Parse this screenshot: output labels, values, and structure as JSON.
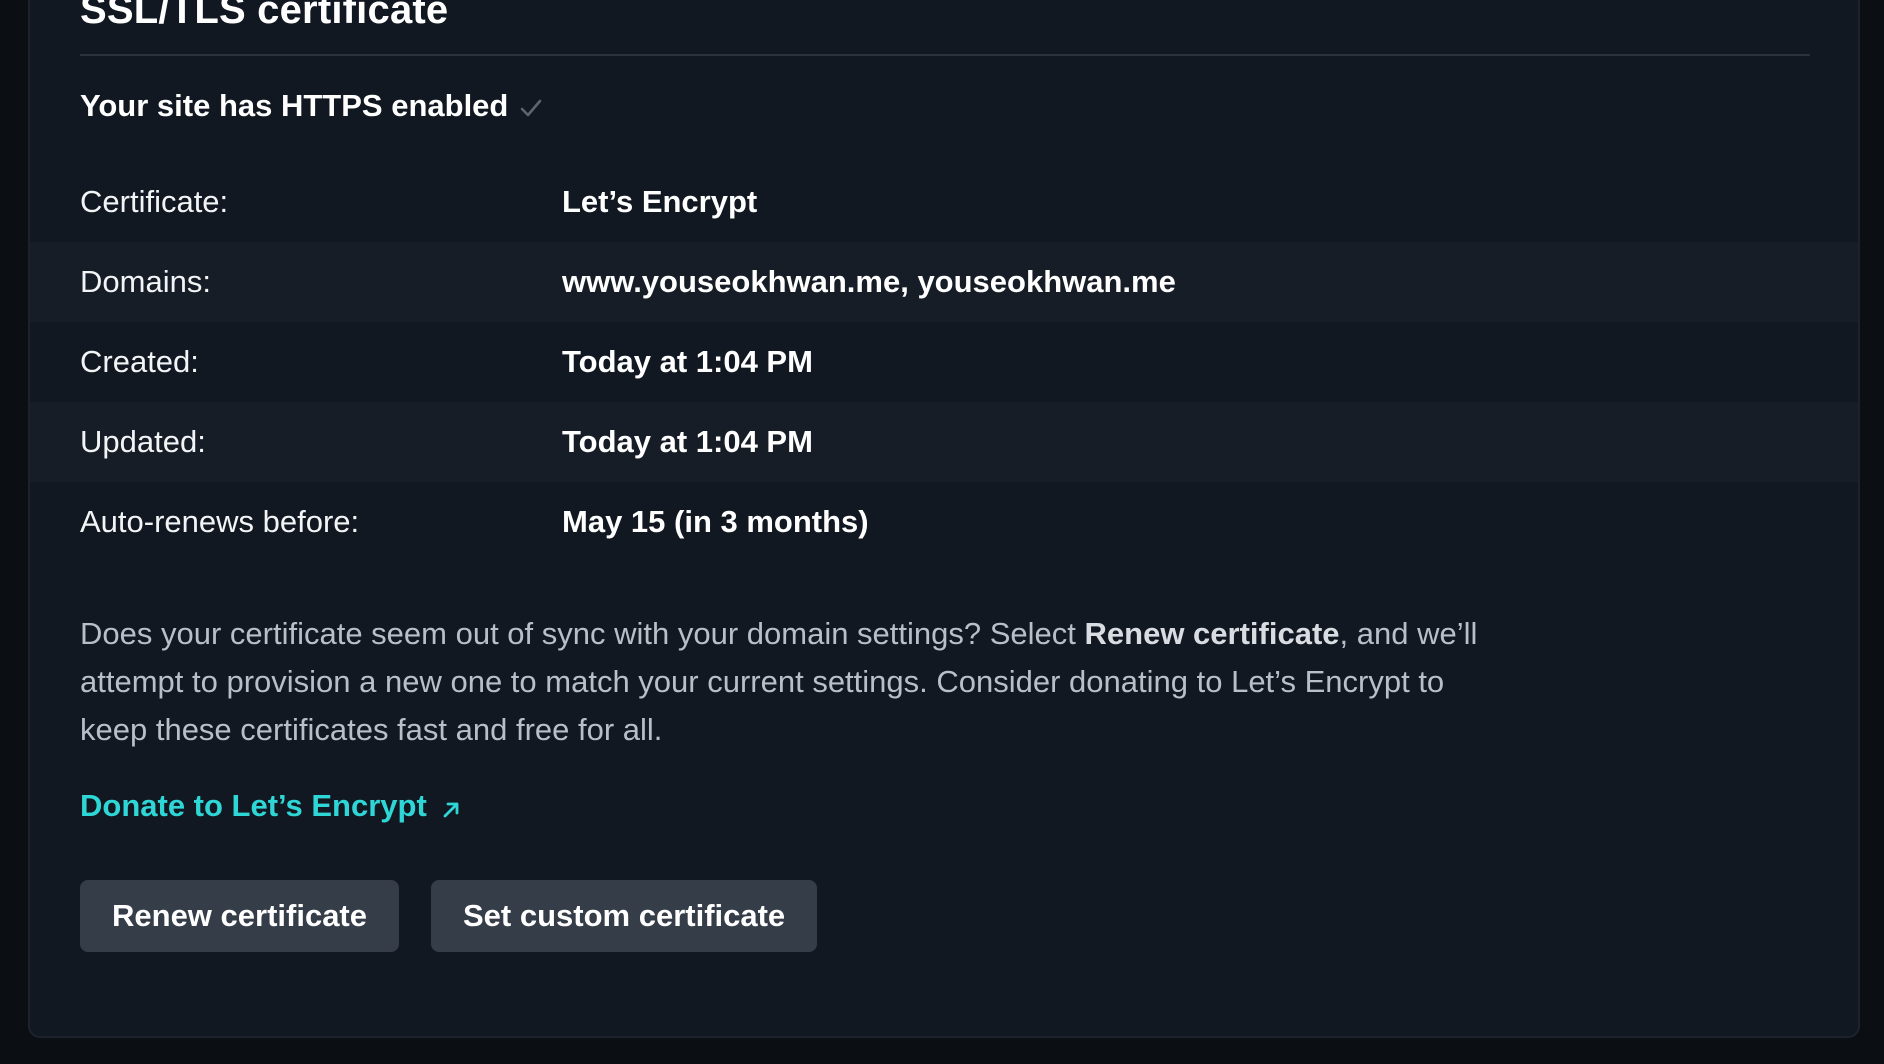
{
  "section": {
    "title": "SSL/TLS certificate",
    "https_status": "Your site has HTTPS enabled"
  },
  "details": [
    {
      "label": "Certificate:",
      "value": "Let’s Encrypt"
    },
    {
      "label": "Domains:",
      "value": "www.youseokhwan.me, youseokhwan.me"
    },
    {
      "label": "Created:",
      "value": "Today at 1:04 PM"
    },
    {
      "label": "Updated:",
      "value": "Today at 1:04 PM"
    },
    {
      "label": "Auto-renews before:",
      "value": "May 15 (in 3 months)"
    }
  ],
  "description": {
    "part1": "Does your certificate seem out of sync with your domain settings? Select ",
    "emphasis": "Renew certificate",
    "part2": ", and we’ll attempt to provision a new one to match your current settings. Consider donating to Let’s Encrypt to keep these certificates fast and free for all."
  },
  "donate_link": {
    "label": "Donate to Let’s Encrypt",
    "icon": "external-arrow-icon"
  },
  "buttons": {
    "renew": "Renew certificate",
    "custom": "Set custom certificate"
  },
  "colors": {
    "background": "#121821",
    "row_alt": "#161d26",
    "link": "#2fd6d6",
    "button": "#353d49",
    "muted_text": "#b8bfc8"
  },
  "icons": {
    "https_check": "check-icon"
  }
}
